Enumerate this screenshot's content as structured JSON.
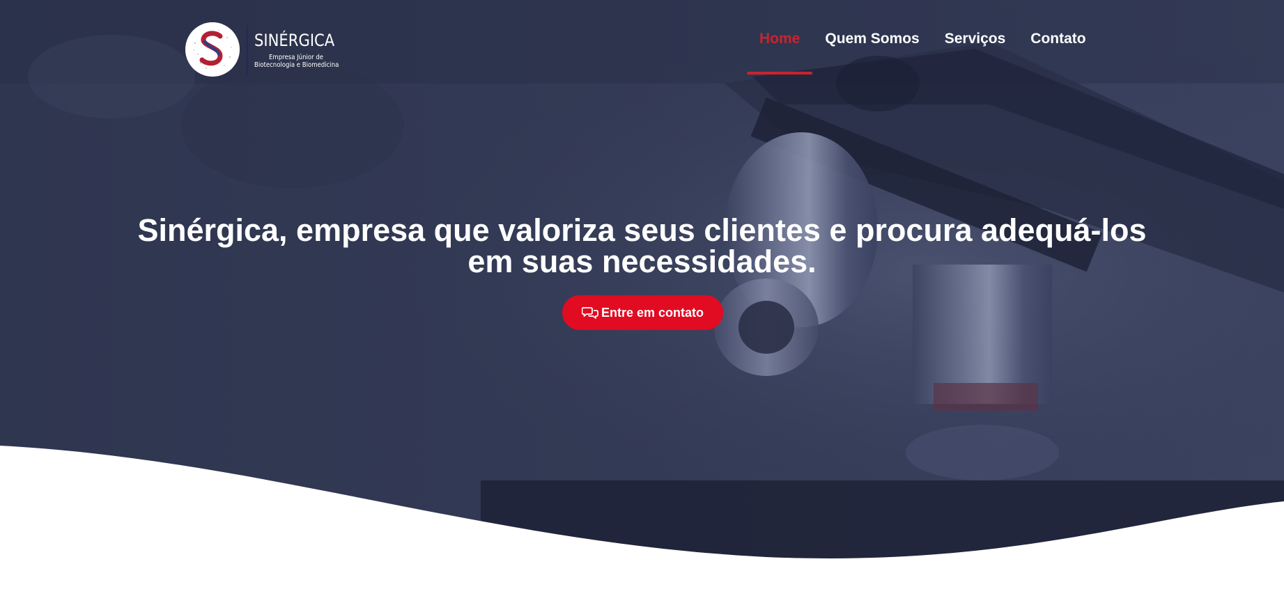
{
  "brand": {
    "name": "SINÉRGICA",
    "tagline_line1": "Empresa Júnior de",
    "tagline_line2": "Biotecnologia e Biomedicina",
    "logo_icon": "s-monogram-logo-icon",
    "colors": {
      "primary_red": "#e10b22",
      "nav_active": "#c8242f",
      "navy": "#2d3552"
    }
  },
  "nav": {
    "items": [
      {
        "label": "Home",
        "active": true
      },
      {
        "label": "Quem Somos",
        "active": false
      },
      {
        "label": "Serviços",
        "active": false
      },
      {
        "label": "Contato",
        "active": false
      }
    ]
  },
  "hero": {
    "headline_line1": "Sinérgica, empresa que valoriza seus clientes e procura adequá-los",
    "headline_line2": "em suas necessidades.",
    "cta_label": "Entre em contato",
    "cta_icon": "chat-bubbles-icon",
    "background": "microscope-photo-with-navy-overlay"
  }
}
